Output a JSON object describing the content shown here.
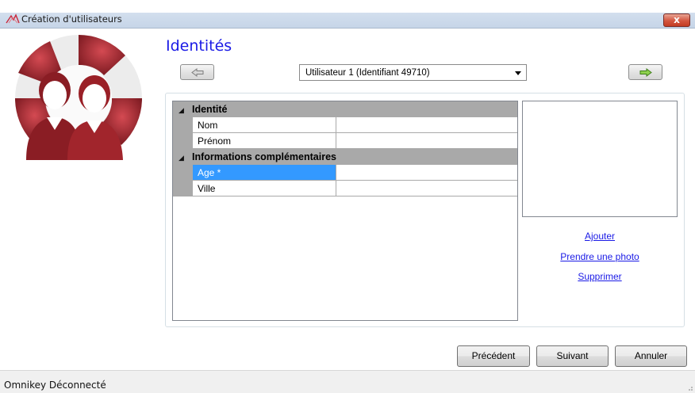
{
  "window": {
    "title": "Création d'utilisateurs",
    "close_label": "x"
  },
  "page": {
    "heading": "Identités"
  },
  "user_selector": {
    "selected": "Utilisateur 1 (Identifiant 49710)"
  },
  "grid": {
    "categories": [
      {
        "label": "Identité",
        "rows": [
          {
            "name": "Nom",
            "value": ""
          },
          {
            "name": "Prénom",
            "value": ""
          }
        ]
      },
      {
        "label": "Informations complémentaires",
        "rows": [
          {
            "name": "Age *",
            "value": "",
            "selected": true
          },
          {
            "name": "Ville",
            "value": ""
          }
        ]
      }
    ]
  },
  "photo": {
    "links": [
      "Ajouter",
      "Prendre une photo",
      "Supprimer"
    ]
  },
  "buttons": {
    "previous": "Précédent",
    "next": "Suivant",
    "cancel": "Annuler"
  },
  "status": {
    "text": "Omnikey Déconnecté"
  },
  "colors": {
    "accent": "#1a1ae6",
    "selection": "#3399ff",
    "logo_red": "#a8262c"
  }
}
